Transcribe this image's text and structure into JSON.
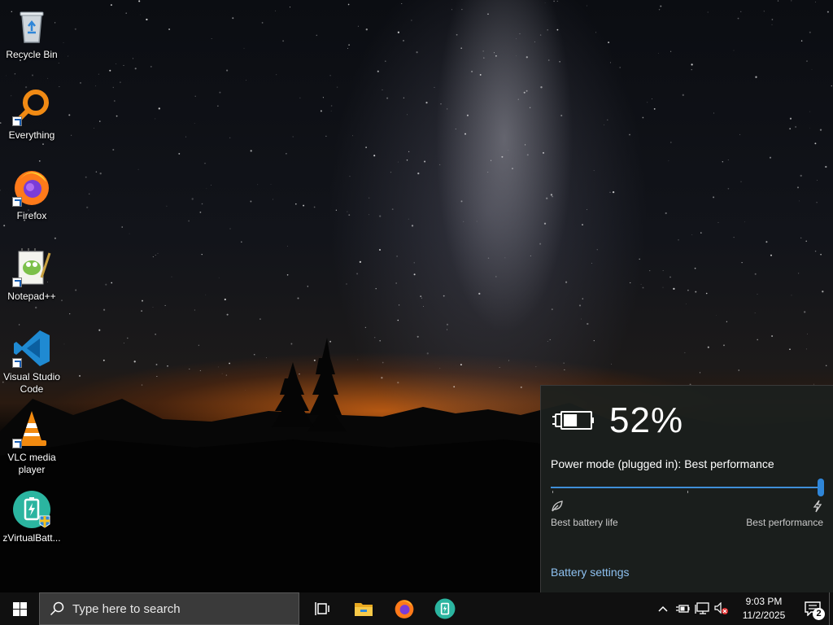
{
  "desktop": {
    "icons": [
      {
        "label": "Recycle Bin",
        "icon": "recycle-bin-icon"
      },
      {
        "label": "Everything",
        "icon": "everything-icon"
      },
      {
        "label": "Firefox",
        "icon": "firefox-icon"
      },
      {
        "label": "Notepad++",
        "icon": "notepadpp-icon"
      },
      {
        "label": "Visual Studio Code",
        "icon": "vscode-icon"
      },
      {
        "label": "VLC media player",
        "icon": "vlc-icon"
      },
      {
        "label": "zVirtualBatt...",
        "icon": "zvirtualbattery-icon"
      }
    ]
  },
  "battery_flyout": {
    "percent": "52%",
    "power_mode_text": "Power mode (plugged in): Best performance",
    "power_slider_level": 1.0,
    "left_label": "Best battery life",
    "right_label": "Best performance",
    "settings_link": "Battery settings",
    "battery_fill_fraction": 0.52
  },
  "taskbar": {
    "search_placeholder": "Type here to search",
    "pinned": [
      {
        "icon": "task-view-icon"
      },
      {
        "icon": "file-explorer-icon"
      },
      {
        "icon": "firefox-icon"
      },
      {
        "icon": "zvirtualbattery-icon"
      }
    ],
    "clock_time": "9:03 PM",
    "clock_date": "11/2/2025",
    "notification_count": "2"
  },
  "colors": {
    "accent": "#2f86d8",
    "link": "#8ec1f0",
    "taskbar": "#101010",
    "flyout_bg": "#1c201e"
  }
}
